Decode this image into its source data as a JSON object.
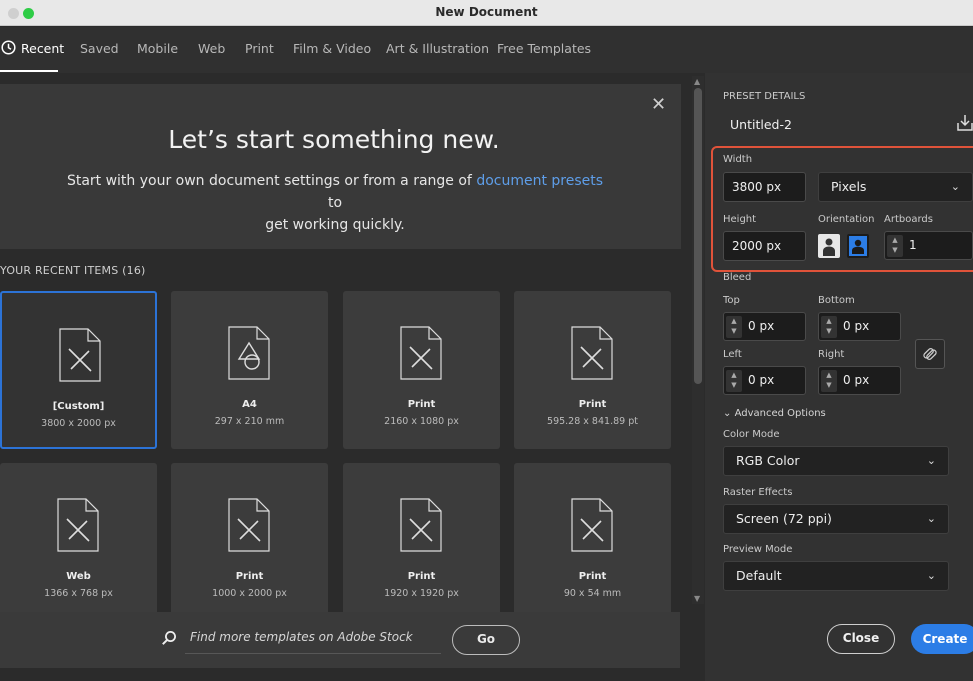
{
  "window": {
    "title": "New Document",
    "traffic_lights": [
      "#cfcfcf",
      "#2ecc46"
    ]
  },
  "tabs": [
    "Recent",
    "Saved",
    "Mobile",
    "Web",
    "Print",
    "Film & Video",
    "Art & Illustration",
    "Free Templates"
  ],
  "hero": {
    "title": "Let’s start something new.",
    "line1_prefix": "Start with your own document settings or from a range of",
    "link": "document presets",
    "line1_suffix": "to",
    "line2": "get working quickly."
  },
  "recent_label": "YOUR RECENT ITEMS",
  "recent_count": "(16)",
  "items": [
    {
      "name": "[Custom]",
      "size": "3800 x 2000 px",
      "icon": "document-pencil-icon"
    },
    {
      "name": "A4",
      "size": "297 x 210 mm",
      "icon": "shapes-document-icon"
    },
    {
      "name": "Print",
      "size": "2160 x 1080 px",
      "icon": "document-pencil-icon"
    },
    {
      "name": "Print",
      "size": "595.28 x 841.89 pt",
      "icon": "document-pencil-icon"
    },
    {
      "name": "Web",
      "size": "1366 x 768 px",
      "icon": "document-pencil-icon"
    },
    {
      "name": "Print",
      "size": "1000 x 2000 px",
      "icon": "document-pencil-icon"
    },
    {
      "name": "Print",
      "size": "1920 x 1920 px",
      "icon": "document-pencil-icon"
    },
    {
      "name": "Print",
      "size": "90 x 54 mm",
      "icon": "document-pencil-icon"
    }
  ],
  "stock": {
    "text": "Find more templates on Adobe Stock",
    "go": "Go"
  },
  "preset": {
    "header": "PRESET DETAILS",
    "name": "Untitled-2",
    "width_label": "Width",
    "width": "3800 px",
    "units": "Pixels",
    "height_label": "Height",
    "height": "2000 px",
    "orientation_label": "Orientation",
    "artboards_label": "Artboards",
    "artboards": "1",
    "bleed_label": "Bleed",
    "top_label": "Top",
    "top": "0 px",
    "bottom_label": "Bottom",
    "bottom": "0 px",
    "left_label": "Left",
    "left": "0 px",
    "right_label": "Right",
    "right": "0 px",
    "advanced": "Advanced Options",
    "color_mode_label": "Color Mode",
    "color_mode": "RGB Color",
    "raster_label": "Raster Effects",
    "raster": "Screen (72 ppi)",
    "preview_label": "Preview Mode",
    "preview": "Default"
  },
  "buttons": {
    "close": "Close",
    "create": "Create"
  },
  "colors": {
    "accent": "#2c7de6",
    "highlight": "#e0533a",
    "link": "#5e9ee9"
  }
}
